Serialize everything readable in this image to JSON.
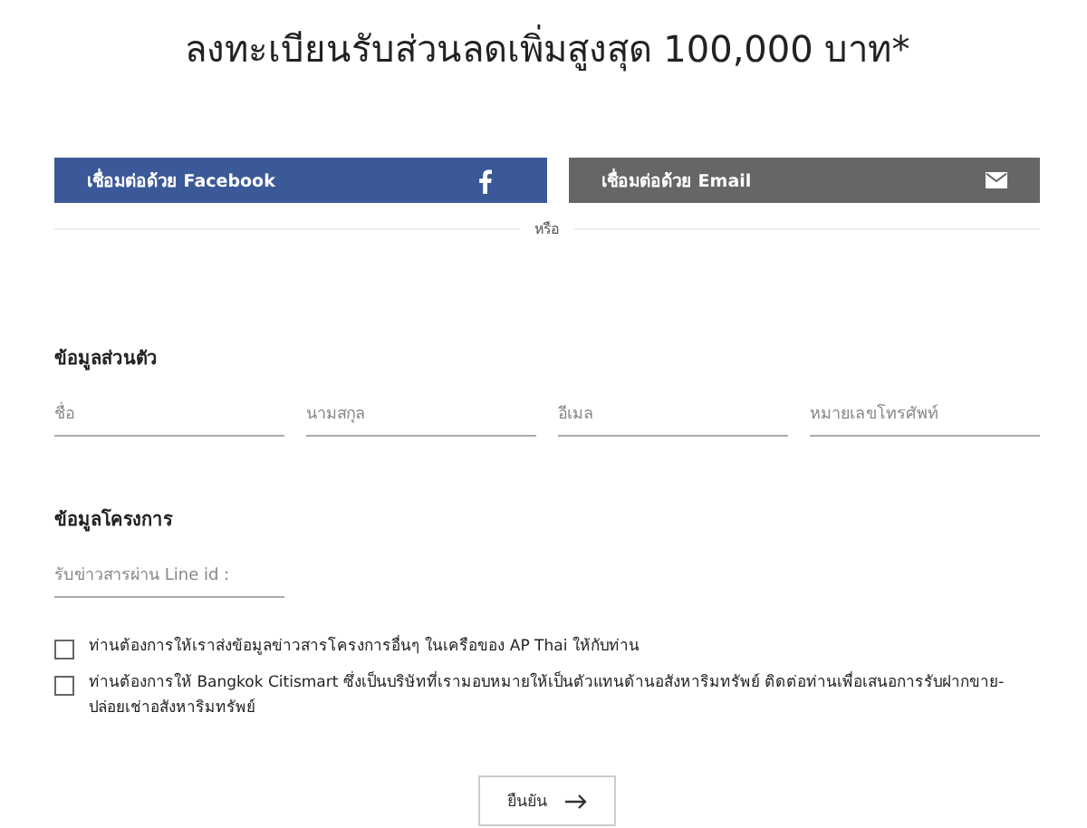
{
  "title": "ลงทะเบียนรับส่วนลดเพิ่มสูงสุด 100,000 บาท*",
  "social_buttons": [
    {
      "kind": "facebook",
      "label": "เชื่อมต่อด้วย Facebook"
    },
    {
      "kind": "email",
      "label": "เชื่อมต่อด้วย Email"
    }
  ],
  "divider_text": "หรือ",
  "personal_section": {
    "heading": "ข้อมูลส่วนตัว",
    "fields": [
      {
        "placeholder": "ชื่อ"
      },
      {
        "placeholder": "นามสกุล"
      },
      {
        "placeholder": "อีเมล"
      },
      {
        "placeholder": "หมายเลขโทรศัพท์"
      }
    ]
  },
  "project_section": {
    "heading": "ข้อมูลโครงการ",
    "fields": [
      {
        "placeholder": "รับข่าวสารผ่าน Line id :"
      }
    ]
  },
  "consents": [
    {
      "label": "ท่านต้องการให้เราส่งข้อมูลข่าวสารโครงการอื่นๆ ในเครือของ AP Thai ให้กับท่าน",
      "checked": false
    },
    {
      "label": "ท่านต้องการให้ Bangkok Citismart ซึ่งเป็นบริษัทที่เรามอบหมายให้เป็นตัวแทนด้านอสังหาริมทรัพย์ ติดต่อท่านเพื่อเสนอการรับฝากขาย-ปล่อยเช่าอสังหาริมทรัพย์",
      "checked": false
    }
  ],
  "submit_button": {
    "label": "ยืนยัน"
  }
}
